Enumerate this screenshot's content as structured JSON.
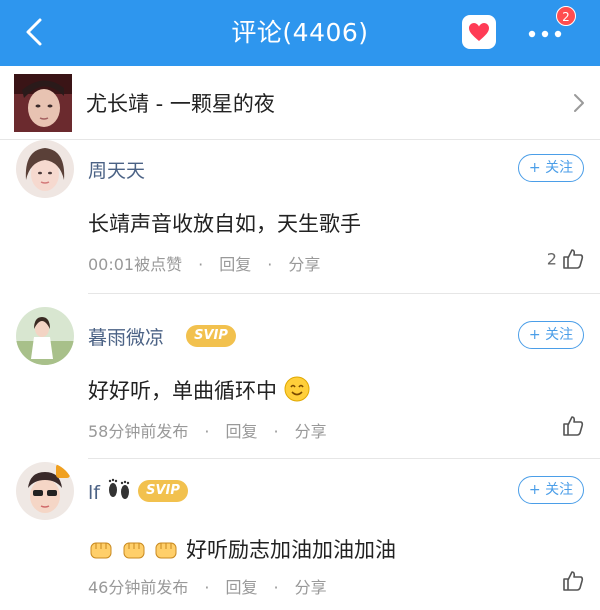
{
  "header": {
    "title": "评论(4406)",
    "badge_count": "2"
  },
  "song": {
    "title": "尤长靖 - 一颗星的夜"
  },
  "comments": [
    {
      "username": "周天天",
      "vip": "",
      "follow_label": "+ 关注",
      "text": "长靖声音收放自如，天生歌手",
      "time": "00:01被点赞",
      "reply_label": "回复",
      "share_label": "分享",
      "likes": "2"
    },
    {
      "username": "暮雨微凉",
      "vip": "SVIP",
      "follow_label": "+ 关注",
      "text": "好好听，单曲循环中",
      "time": "58分钟前发布",
      "reply_label": "回复",
      "share_label": "分享",
      "likes": ""
    },
    {
      "username": "lf",
      "vip": "SVIP",
      "follow_label": "+ 关注",
      "text": "好听励志加油加油加油",
      "time": "46分钟前发布",
      "reply_label": "回复",
      "share_label": "分享",
      "likes": ""
    }
  ],
  "colors": {
    "topbar": "#2e96ee",
    "username": "#4b6285",
    "follow": "#4b9ee8",
    "vip": "#f2c14e"
  }
}
